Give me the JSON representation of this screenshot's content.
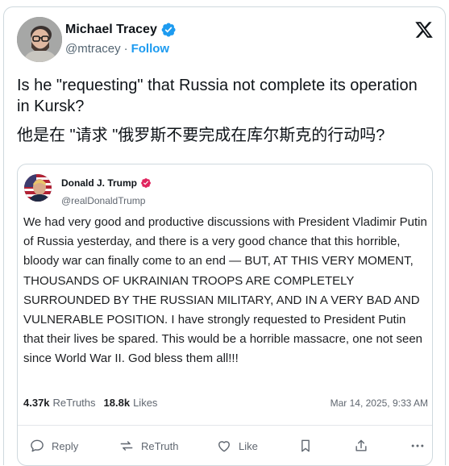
{
  "tweet": {
    "author_name": "Michael Tracey",
    "handle": "@mtracey",
    "separator": "·",
    "follow_label": "Follow",
    "text": "Is he \"requesting\" that Russia not complete its operation in Kursk?",
    "text_zh": "他是在 \"请求 \"俄罗斯不要完成在库尔斯克的行动吗?",
    "icons": [
      "verified-badge-icon",
      "x-logo-icon"
    ],
    "colors": {
      "accent": "#1d9bf0",
      "text": "#0f1419",
      "muted": "#536471"
    }
  },
  "quoted_post": {
    "author_name": "Donald J. Trump",
    "handle": "@realDonaldTrump",
    "body": "We had very good and productive discussions with President Vladimir Putin of Russia yesterday, and there is a very good chance that this horrible, bloody war can finally come to an end — BUT, AT THIS VERY MOMENT, THOUSANDS OF UKRAINIAN TROOPS ARE COMPLETELY SURROUNDED BY THE RUSSIAN MILITARY, AND IN A VERY BAD AND VULNERABLE POSITION. I have strongly requested to President Putin that their lives be spared. This would be a horrible massacre, one not seen since World War II. God bless them all!!!",
    "retruths_count": "4.37k",
    "retruths_label": "ReTruths",
    "likes_count": "18.8k",
    "likes_label": "Likes",
    "date": "Mar 14, 2025, 9:33 AM",
    "actions": {
      "reply": "Reply",
      "retruth": "ReTruth",
      "like": "Like"
    },
    "icons": [
      "verified-badge-icon",
      "reply-icon",
      "retruth-icon",
      "heart-icon",
      "bookmark-icon",
      "share-icon",
      "more-icon"
    ],
    "colors": {
      "badge": "#e0245e"
    }
  }
}
